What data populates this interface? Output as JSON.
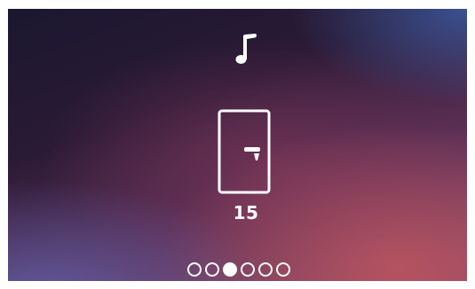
{
  "screen": {
    "counter_value": "15",
    "icons": {
      "top": "music-note-icon",
      "center": "door-icon"
    },
    "pagination": {
      "total_pages": 6,
      "active_index": 2
    },
    "colors": {
      "foreground": "#ffffff",
      "background_dark": "#1b1730",
      "background_warm": "#be555f",
      "background_cool": "#3c5aa0"
    }
  }
}
